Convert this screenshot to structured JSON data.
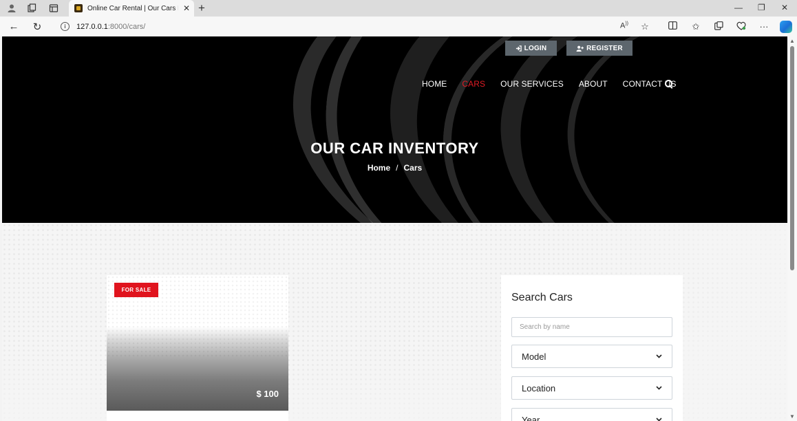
{
  "browser": {
    "tab_title": "Online Car Rental | Our Cars Inve",
    "url_host": "127.0.0.1",
    "url_path": ":8000/cars/"
  },
  "header": {
    "login_label": "LOGIN",
    "register_label": "REGISTER",
    "nav": [
      {
        "label": "HOME",
        "active": false
      },
      {
        "label": "CARS",
        "active": true
      },
      {
        "label": "OUR SERVICES",
        "active": false
      },
      {
        "label": "ABOUT",
        "active": false
      },
      {
        "label": "CONTACT US",
        "active": false
      }
    ]
  },
  "hero": {
    "title": "OUR CAR INVENTORY",
    "breadcrumb_home": "Home",
    "breadcrumb_sep": "/",
    "breadcrumb_current": "Cars"
  },
  "car_card": {
    "badge": "FOR SALE",
    "price": "$ 100"
  },
  "search": {
    "heading": "Search Cars",
    "name_placeholder": "Search by name",
    "model_label": "Model",
    "location_label": "Location",
    "year_label": "Year"
  },
  "colors": {
    "accent_red": "#e01b24",
    "badge_red": "#e0141e",
    "button_gray": "#5d666d"
  }
}
